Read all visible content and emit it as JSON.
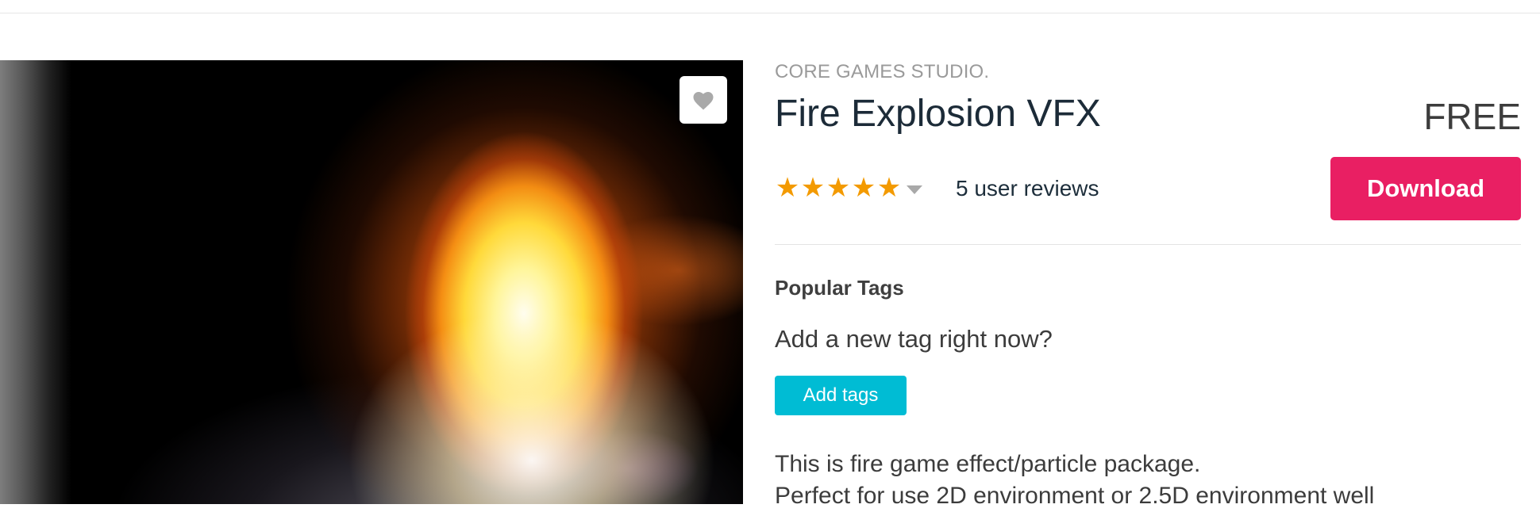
{
  "product": {
    "publisher": "CORE GAMES STUDIO.",
    "title": "Fire Explosion VFX",
    "price": "FREE",
    "rating": {
      "stars": 5,
      "max_stars": 5,
      "reviews_text": "5 user reviews"
    },
    "download_label": "Download",
    "image_alt": "fire explosion preview"
  },
  "tags": {
    "heading": "Popular Tags",
    "prompt": "Add a new tag right now?",
    "add_label": "Add tags"
  },
  "description": {
    "lines": [
      "This is fire game effect/particle package.",
      "Perfect for use 2D environment or 2.5D environment well"
    ]
  },
  "icons": {
    "favorite": "heart-icon",
    "star": "star-icon",
    "dropdown": "caret-down-icon"
  },
  "colors": {
    "accent_download": "#e91f63",
    "accent_tags": "#00bcd4",
    "star": "#f39a00",
    "title": "#1c2b38"
  }
}
